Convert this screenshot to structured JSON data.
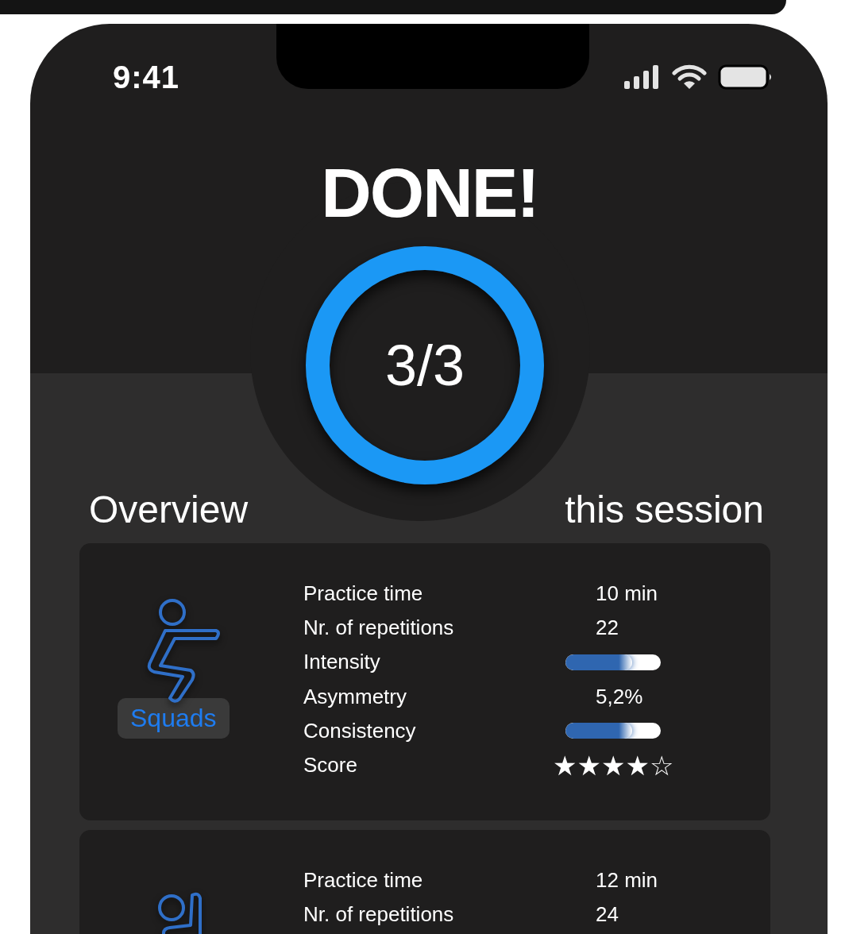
{
  "status_bar": {
    "time": "9:41"
  },
  "title": "DONE!",
  "progress": {
    "label": "3/3",
    "level": 1
  },
  "overview": {
    "title": "Overview",
    "subtitle": "this session"
  },
  "exercises": [
    {
      "kind": "squat",
      "name": "Squads",
      "stats": [
        {
          "kind": "text",
          "label": "Practice time",
          "value": "10 min"
        },
        {
          "kind": "text",
          "label": "Nr. of repetitions",
          "value": "22"
        },
        {
          "kind": "bar",
          "label": "Intensity",
          "level": 0.7
        },
        {
          "kind": "text",
          "label": "Asymmetry",
          "value": "5,2%"
        },
        {
          "kind": "bar",
          "label": "Consistency",
          "level": 0.7
        },
        {
          "kind": "stars",
          "label": "Score",
          "stars": 4
        }
      ]
    },
    {
      "kind": "raise",
      "stats": [
        {
          "kind": "text",
          "label": "Practice time",
          "value": "12 min"
        },
        {
          "kind": "text",
          "label": "Nr. of repetitions",
          "value": "24"
        }
      ]
    }
  ]
}
